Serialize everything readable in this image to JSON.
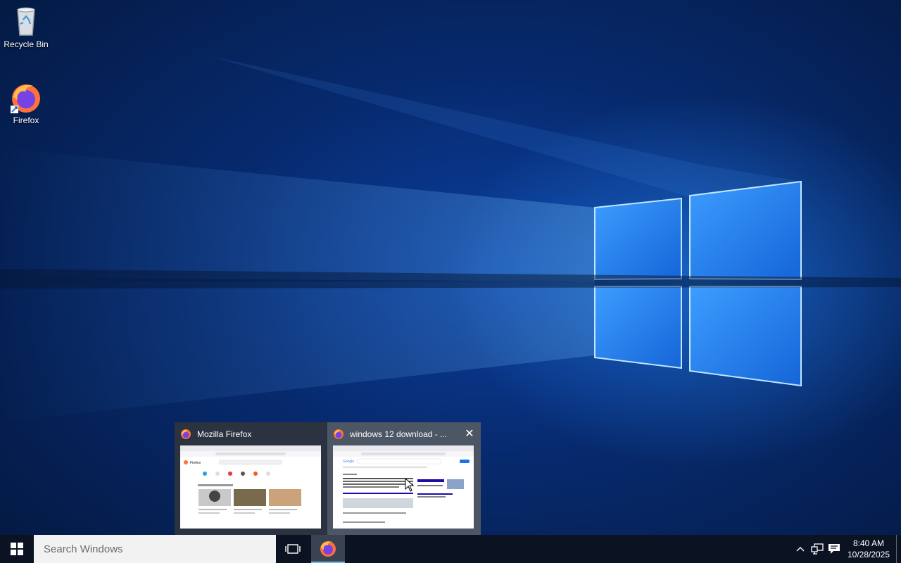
{
  "desktop": {
    "icons": [
      {
        "label": "Recycle Bin",
        "icon": "recycle-bin-icon"
      },
      {
        "label": "Firefox",
        "icon": "firefox-icon"
      }
    ]
  },
  "thumbnails": [
    {
      "title": "Mozilla Firefox",
      "icon": "firefox-icon",
      "preview_brand": "Firefox"
    },
    {
      "title": "windows 12 download - ...",
      "icon": "firefox-icon",
      "close_label": "✕",
      "preview_brand": "Google"
    }
  ],
  "taskbar": {
    "search_placeholder": "Search Windows",
    "apps": [
      {
        "name": "Firefox",
        "icon": "firefox-icon",
        "active": true
      }
    ],
    "clock": {
      "time": "8:40 AM",
      "date": "10/28/2025"
    }
  },
  "colors": {
    "taskbar": "#0b1322",
    "search_bg": "#f2f2f2",
    "accent": "#76b9ed",
    "popup_bg": "#2d3440"
  }
}
